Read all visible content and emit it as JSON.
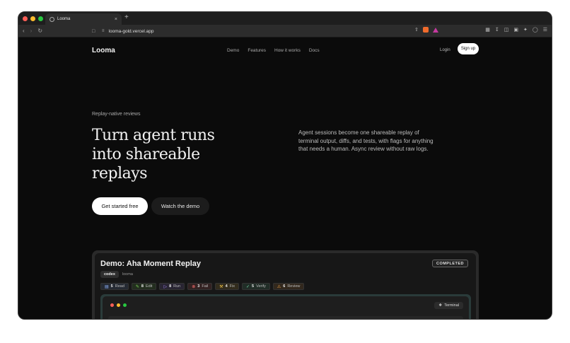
{
  "browser": {
    "tab_title": "Looma",
    "tab_close": "×",
    "new_tab": "+",
    "url": "looma-gold.vercel.app",
    "traffic_colors": [
      "#ff5f57",
      "#febc2e",
      "#28c840"
    ]
  },
  "header": {
    "logo": "Looma",
    "nav": [
      "Demo",
      "Features",
      "How it works",
      "Docs"
    ],
    "login": "Login",
    "signup": "Sign up"
  },
  "hero": {
    "eyebrow": "Replay-native reviews",
    "headline": "Turn agent runs into shareable replays",
    "description": "Agent sessions become one shareable replay of terminal output, diffs, and tests, with flags for anything that needs a human. Async review without raw logs.",
    "cta_primary": "Get started free",
    "cta_secondary": "Watch the demo"
  },
  "demo": {
    "title": "Demo: Aha Moment Replay",
    "status": "COMPLETED",
    "tags": [
      "codex",
      "looma"
    ],
    "steps": [
      {
        "icon": "book-icon",
        "glyph": "▤",
        "count": "5",
        "label": "Read",
        "color": "#8fb4ff"
      },
      {
        "icon": "pencil-icon",
        "glyph": "✎",
        "count": "8",
        "label": "Edit",
        "color": "#7ed957"
      },
      {
        "icon": "play-icon",
        "glyph": "▷",
        "count": "8",
        "label": "Run",
        "color": "#a98bff"
      },
      {
        "icon": "x-circle-icon",
        "glyph": "⊗",
        "count": "3",
        "label": "Fail",
        "color": "#ff7070"
      },
      {
        "icon": "wrench-icon",
        "glyph": "⚒",
        "count": "4",
        "label": "Fix",
        "color": "#f3c546"
      },
      {
        "icon": "check-circle-icon",
        "glyph": "✓",
        "count": "5",
        "label": "Verify",
        "color": "#6fd1a0"
      },
      {
        "icon": "warning-icon",
        "glyph": "⚠",
        "count": "6",
        "label": "Review",
        "color": "#f3a646"
      }
    ],
    "terminal_label": "Terminal"
  }
}
